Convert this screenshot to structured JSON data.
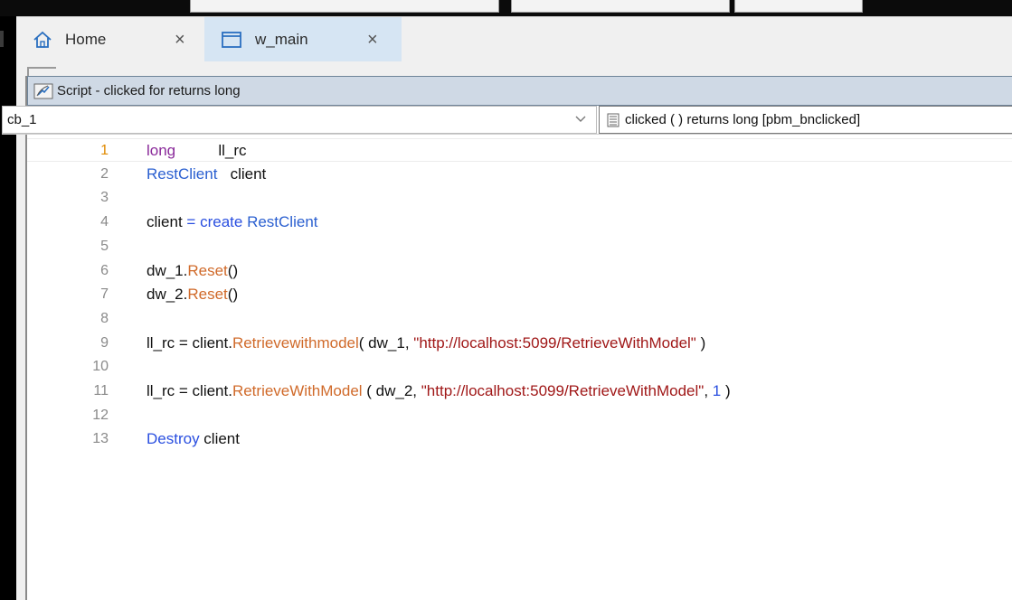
{
  "tabs": [
    {
      "label": "Home",
      "icon": "home-icon"
    },
    {
      "label": "w_main",
      "icon": "window-icon",
      "active": true
    }
  ],
  "close_glyph": "×",
  "script_window": {
    "title": "Script - clicked for  returns long",
    "object_select": "cb_1",
    "event_select": "clicked ( )  returns long [pbm_bnclicked]"
  },
  "code_lines": [
    {
      "n": "1",
      "tokens": [
        {
          "t": "long",
          "c": "kw-type"
        },
        {
          "t": "          ll_rc",
          "c": ""
        }
      ]
    },
    {
      "n": "2",
      "tokens": [
        {
          "t": "RestClient",
          "c": "kw-obj"
        },
        {
          "t": "   client",
          "c": ""
        }
      ]
    },
    {
      "n": "3",
      "tokens": []
    },
    {
      "n": "4",
      "tokens": [
        {
          "t": "client ",
          "c": ""
        },
        {
          "t": "=",
          "c": "op"
        },
        {
          "t": " ",
          "c": ""
        },
        {
          "t": "create",
          "c": "kw-blue"
        },
        {
          "t": " ",
          "c": ""
        },
        {
          "t": "RestClient",
          "c": "kw-obj"
        }
      ]
    },
    {
      "n": "5",
      "tokens": []
    },
    {
      "n": "6",
      "tokens": [
        {
          "t": "dw_1.",
          "c": ""
        },
        {
          "t": "Reset",
          "c": "fn"
        },
        {
          "t": "()",
          "c": ""
        }
      ]
    },
    {
      "n": "7",
      "tokens": [
        {
          "t": "dw_2.",
          "c": ""
        },
        {
          "t": "Reset",
          "c": "fn"
        },
        {
          "t": "()",
          "c": ""
        }
      ]
    },
    {
      "n": "8",
      "tokens": []
    },
    {
      "n": "9",
      "tokens": [
        {
          "t": "ll_rc = client.",
          "c": ""
        },
        {
          "t": "Retrievewithmodel",
          "c": "fn"
        },
        {
          "t": "( dw_1, ",
          "c": ""
        },
        {
          "t": "\"http://localhost:5099/RetrieveWithModel\"",
          "c": "str"
        },
        {
          "t": " )",
          "c": ""
        }
      ]
    },
    {
      "n": "10",
      "tokens": []
    },
    {
      "n": "11",
      "tokens": [
        {
          "t": "ll_rc = client.",
          "c": ""
        },
        {
          "t": "RetrieveWithModel",
          "c": "fn"
        },
        {
          "t": " ( dw_2, ",
          "c": ""
        },
        {
          "t": "\"http://localhost:5099/RetrieveWithModel\"",
          "c": "str"
        },
        {
          "t": ", ",
          "c": ""
        },
        {
          "t": "1",
          "c": "num"
        },
        {
          "t": " )",
          "c": ""
        }
      ]
    },
    {
      "n": "12",
      "tokens": []
    },
    {
      "n": "13",
      "tokens": [
        {
          "t": "Destroy",
          "c": "kw-blue"
        },
        {
          "t": " client",
          "c": ""
        }
      ]
    }
  ],
  "colors": {
    "active_tab": "#d6e5f3",
    "title_bar": "#cfd9e5",
    "line_number_active": "#e08a00",
    "keyword_type": "#8a2a9a",
    "keyword_object": "#2a5fd0",
    "function": "#d06a2a",
    "string": "#a01818"
  }
}
